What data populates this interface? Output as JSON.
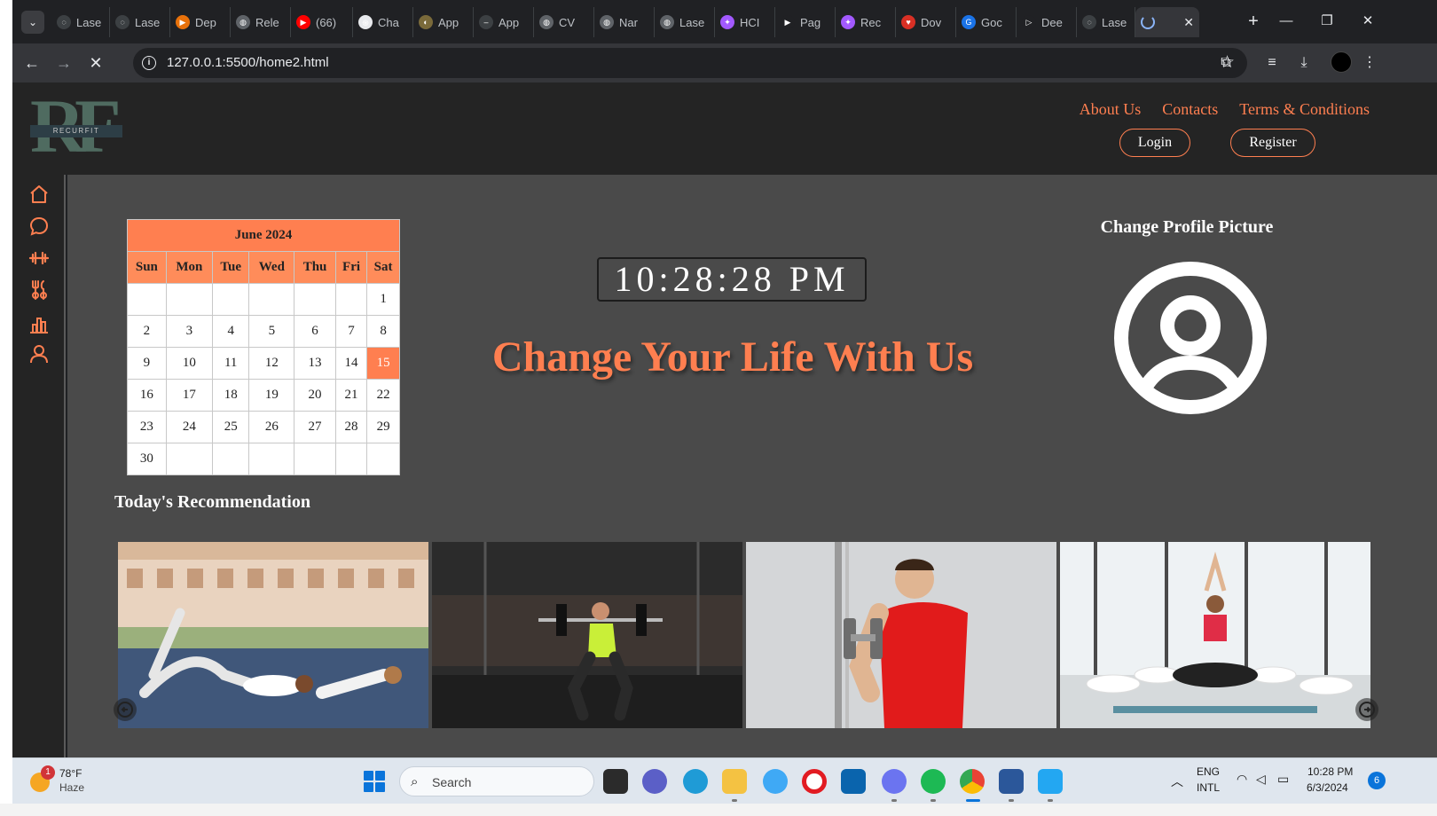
{
  "browser": {
    "tabs": [
      {
        "label": "Lase",
        "fav_color": "#3c4043",
        "fav_glyph": "◌"
      },
      {
        "label": "Lase",
        "fav_color": "#3c4043",
        "fav_glyph": "◌"
      },
      {
        "label": "Dep",
        "fav_color": "#e8710a",
        "fav_glyph": "▶"
      },
      {
        "label": "Rele",
        "fav_color": "#5f6368",
        "fav_glyph": "◍"
      },
      {
        "label": "(66)",
        "fav_color": "#ff0000",
        "fav_glyph": "▶"
      },
      {
        "label": "Cha",
        "fav_color": "#e8eaed",
        "fav_glyph": "֍"
      },
      {
        "label": "App",
        "fav_color": "#7a6a3a",
        "fav_glyph": "◐"
      },
      {
        "label": "App",
        "fav_color": "#3c4043",
        "fav_glyph": "‒"
      },
      {
        "label": "CV",
        "fav_color": "#5f6368",
        "fav_glyph": "◍"
      },
      {
        "label": "Nar",
        "fav_color": "#5f6368",
        "fav_glyph": "◍"
      },
      {
        "label": "Lase",
        "fav_color": "#5f6368",
        "fav_glyph": "◍"
      },
      {
        "label": "HCI",
        "fav_color": "#a259ff",
        "fav_glyph": "✦"
      },
      {
        "label": "Pag",
        "fav_color": "#202124",
        "fav_glyph": "▶"
      },
      {
        "label": "Rec",
        "fav_color": "#a259ff",
        "fav_glyph": "✦"
      },
      {
        "label": "Dov",
        "fav_color": "#d93025",
        "fav_glyph": "♥"
      },
      {
        "label": "Goc",
        "fav_color": "#1a73e8",
        "fav_glyph": "G"
      },
      {
        "label": "Dee",
        "fav_color": "#202124",
        "fav_glyph": "▷"
      },
      {
        "label": "Lase",
        "fav_color": "#3c4043",
        "fav_glyph": "◌"
      }
    ],
    "active_tab_close": "✕",
    "new_tab": "+",
    "url": "127.0.0.1:5500/home2.html"
  },
  "header": {
    "logo_letters": "RF",
    "logo_text": "RECURFIT",
    "nav": [
      "About Us",
      "Contacts",
      "Terms & Conditions"
    ],
    "login_label": "Login",
    "register_label": "Register",
    "accent_color": "#ff7f50"
  },
  "sidebar": {
    "items": [
      "home-icon",
      "chat-icon",
      "dumbbell-icon",
      "fork-knife-icon",
      "bar-chart-icon",
      "user-icon"
    ]
  },
  "calendar": {
    "title": "June 2024",
    "weekdays": [
      "Sun",
      "Mon",
      "Tue",
      "Wed",
      "Thu",
      "Fri",
      "Sat"
    ],
    "weeks": [
      [
        "",
        "",
        "",
        "",
        "",
        "",
        "1"
      ],
      [
        "2",
        "3",
        "4",
        "5",
        "6",
        "7",
        "8"
      ],
      [
        "9",
        "10",
        "11",
        "12",
        "13",
        "14",
        "15"
      ],
      [
        "16",
        "17",
        "18",
        "19",
        "20",
        "21",
        "22"
      ],
      [
        "23",
        "24",
        "25",
        "26",
        "27",
        "28",
        "29"
      ],
      [
        "30",
        "",
        "",
        "",
        "",
        "",
        ""
      ]
    ],
    "today": "15"
  },
  "clock": {
    "time": "10:28:28 PM"
  },
  "hero": {
    "headline": "Change Your Life With Us"
  },
  "profile": {
    "title": "Change Profile Picture"
  },
  "recommendations": {
    "title": "Today's Recommendation",
    "cards": [
      {
        "name": "rec-card-outdoor-abs"
      },
      {
        "name": "rec-card-barbell-squat"
      },
      {
        "name": "rec-card-dumbbell-curl"
      },
      {
        "name": "rec-card-yoga-class"
      }
    ]
  },
  "taskbar": {
    "weather_badge": "1",
    "weather_temp": "78°F",
    "weather_condition": "Haze",
    "search_label": "Search",
    "language_top": "ENG",
    "language_bottom": "INTL",
    "time": "10:28 PM",
    "date": "6/3/2024",
    "notification_count": "6"
  }
}
